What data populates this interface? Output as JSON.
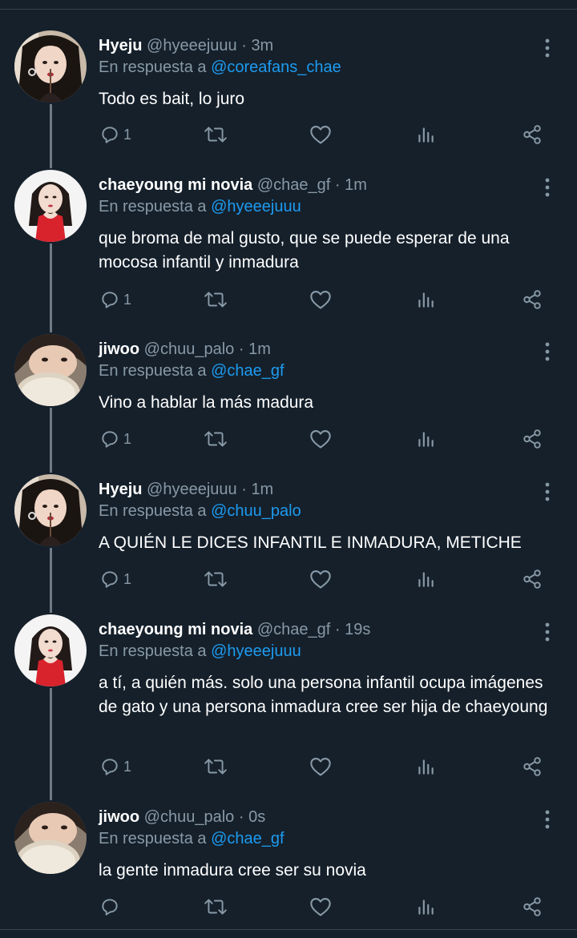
{
  "reply_prefix": "En respuesta a ",
  "tweets": [
    {
      "name": "Hyeju",
      "handle": "@hyeeejuuu",
      "time": "3m",
      "reply_to": "@coreafans_chae",
      "text": "Todo es bait, lo juro",
      "reply_count": "1",
      "avatar": "avatar-hyeju"
    },
    {
      "name": "chaeyoung mi novia",
      "handle": "@chae_gf",
      "time": "1m",
      "reply_to": "@hyeeejuuu",
      "text": "que broma de mal gusto, que se puede esperar de una mocosa infantil y inmadura",
      "reply_count": "1",
      "avatar": "avatar-chaeyoung"
    },
    {
      "name": "jiwoo",
      "handle": "@chuu_palo",
      "time": "1m",
      "reply_to": "@chae_gf",
      "text": "Vino a hablar la más madura",
      "reply_count": "1",
      "avatar": "avatar-jiwoo"
    },
    {
      "name": "Hyeju",
      "handle": "@hyeeejuuu",
      "time": "1m",
      "reply_to": "@chuu_palo",
      "text": "A QUIÉN LE DICES INFANTIL E INMADURA, METICHE",
      "reply_count": "1",
      "avatar": "avatar-hyeju"
    },
    {
      "name": "chaeyoung mi novia",
      "handle": "@chae_gf",
      "time": "19s",
      "reply_to": "@hyeeejuuu",
      "text": "a tí, a quién más. solo una persona infantil ocupa imágenes de gato y una persona inmadura cree ser hija de chaeyoung",
      "reply_count": "1",
      "avatar": "avatar-chaeyoung"
    },
    {
      "name": "jiwoo",
      "handle": "@chuu_palo",
      "time": "0s",
      "reply_to": "@chae_gf",
      "text": "la gente inmadura cree ser su novia",
      "reply_count": "",
      "avatar": "avatar-jiwoo"
    }
  ],
  "icons": {
    "reply": "reply-icon",
    "retweet": "retweet-icon",
    "like": "heart-icon",
    "stats": "stats-icon",
    "share": "share-icon",
    "more": "more-icon"
  },
  "colors": {
    "background": "#15202b",
    "secondary_text": "#8899a6",
    "mention": "#1d9bf0",
    "divider": "#38444d"
  }
}
